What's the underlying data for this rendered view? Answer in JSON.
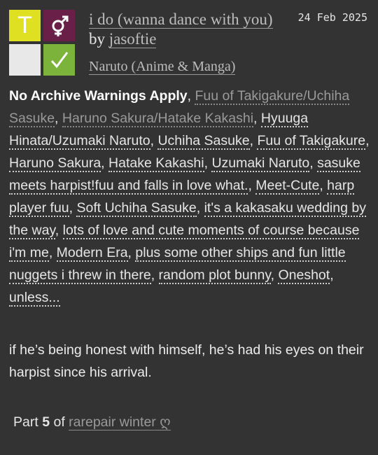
{
  "work": {
    "rating_letter": "T",
    "category_symbol": "⚥",
    "complete_symbol": "✓",
    "title": "i do (wanna dance with you)",
    "by_word": "by",
    "author": "jasoftie",
    "date": "24 Feb 2025",
    "fandom": "Naruto (Anime & Manga)"
  },
  "tags": {
    "warning": "No Archive Warnings Apply",
    "relationships": [
      "Fuu of Takigakure/Uchiha Sasuke",
      "Haruno Sakura/Hatake Kakashi"
    ],
    "freeforms": [
      "Hyuuga Hinata/Uzumaki Naruto",
      "Uchiha Sasuke",
      "Fuu of Takigakure",
      "Haruno Sakura",
      "Hatake Kakashi",
      "Uzumaki Naruto",
      "sasuke meets harpist!fuu and falls in love what.",
      "Meet-Cute",
      "harp player fuu",
      "Soft Uchiha Sasuke",
      "it's a kakasaku wedding by the way",
      "lots of love and cute moments of course because i'm me",
      "Modern Era",
      "plus some other ships and fun little nuggets i threw in there",
      "random plot bunny",
      "Oneshot",
      "unless..."
    ]
  },
  "summary": "if he’s being honest with himself, he’s had his eyes on their harpist since his arrival.",
  "series": {
    "prefix": "Part",
    "part_number": "5",
    "of_word": "of",
    "name": "rarepair winter ღ"
  },
  "colors": {
    "background": "#333333",
    "rating_general": "#e0e022",
    "category_multi": "#6a1f48",
    "no_warnings": "#e8e8e8",
    "complete": "#7cb33a"
  }
}
